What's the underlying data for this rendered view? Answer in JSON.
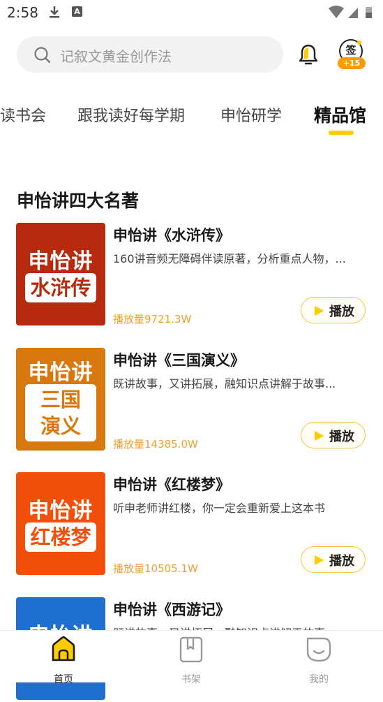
{
  "status_bar": {
    "time": "2:58"
  },
  "search": {
    "placeholder": "记叙文黄金创作法"
  },
  "sign": {
    "label": "签",
    "bonus": "+15"
  },
  "tabs": [
    {
      "label": "读书会"
    },
    {
      "label": "跟我读好每学期"
    },
    {
      "label": "申怡研学"
    },
    {
      "label": "精品馆",
      "active": true
    }
  ],
  "section": {
    "title": "申怡讲四大名著"
  },
  "items": [
    {
      "title": "申怡讲《水浒传》",
      "desc": "160讲音频无障碍伴读原著，分析重点人物，...",
      "plays": "播放量9721.3W",
      "cover_top": "申怡讲",
      "cover_box": "水浒传",
      "cover_color": "#b82a0e"
    },
    {
      "title": "申怡讲《三国演义》",
      "desc": "既讲故事，又讲拓展，融知识点讲解于故事...",
      "plays": "播放量14385.0W",
      "cover_top": "申怡讲",
      "cover_box_line1": "三国",
      "cover_box_line2": "演义",
      "cover_color": "#d9780f"
    },
    {
      "title": "申怡讲《红楼梦》",
      "desc": "听申老师讲红楼，你一定会重新爱上这本书",
      "plays": "播放量10505.1W",
      "cover_top": "申怡讲",
      "cover_box": "红楼梦",
      "cover_color": "#f2500a"
    },
    {
      "title": "申怡讲《西游记》",
      "desc": "既讲故事，又讲拓展，融知识点讲解于故事...",
      "cover_top": "申怡讲",
      "cover_color": "#1f6fd0"
    }
  ],
  "play_label": "播放",
  "bottom_nav": [
    {
      "label": "首页",
      "active": true
    },
    {
      "label": "书架"
    },
    {
      "label": "我的"
    }
  ],
  "colors": {
    "accent": "#ffcc00",
    "plays": "#f0a030"
  }
}
